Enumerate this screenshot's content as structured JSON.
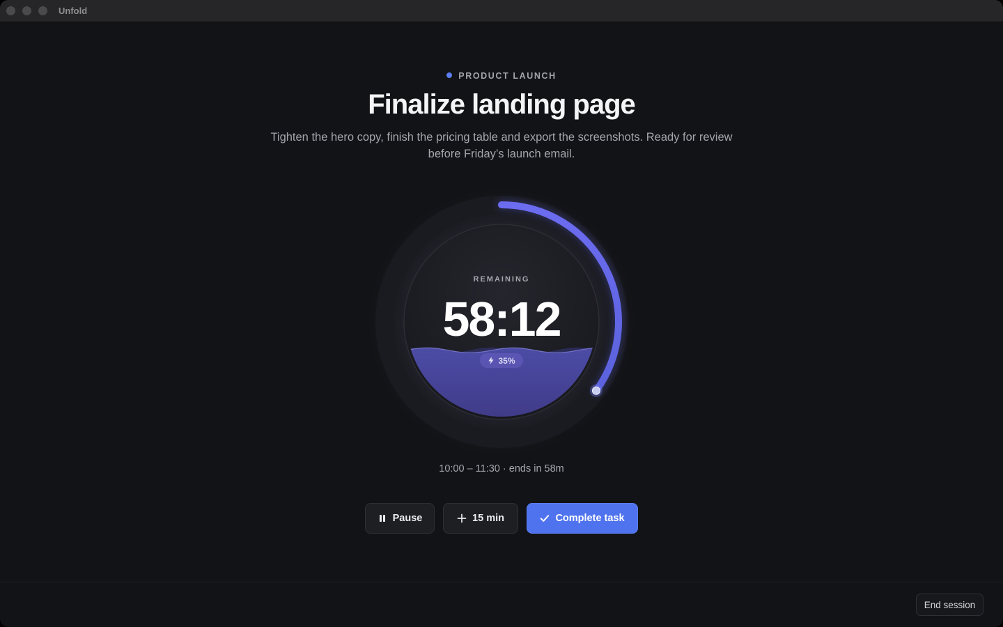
{
  "window": {
    "app_title": "Unfold"
  },
  "task": {
    "project": "PRODUCT LAUNCH",
    "project_color": "#5b7cf2",
    "title": "Finalize landing page",
    "description": "Tighten the hero copy, finish the pricing table and export the screenshots. Ready for review before Friday’s launch email."
  },
  "timer": {
    "label": "REMAINING",
    "time": "58:12",
    "elapsed_fraction": 0.35,
    "fill_fraction": 0.35,
    "energy_icon": "lightning-bolt-icon",
    "energy_label": "35%",
    "accent_color": "#5b5fe0"
  },
  "schedule": {
    "text": "10:00 – 11:30 · ends in 58m"
  },
  "actions": {
    "pause_label": "Pause",
    "pause_icon": "pause-icon",
    "extend_label": "15 min",
    "extend_icon": "plus-icon",
    "complete_label": "Complete task",
    "complete_icon": "checkmark-icon",
    "primary_color": "#4f73ee"
  },
  "footer": {
    "end_session_label": "End session"
  }
}
